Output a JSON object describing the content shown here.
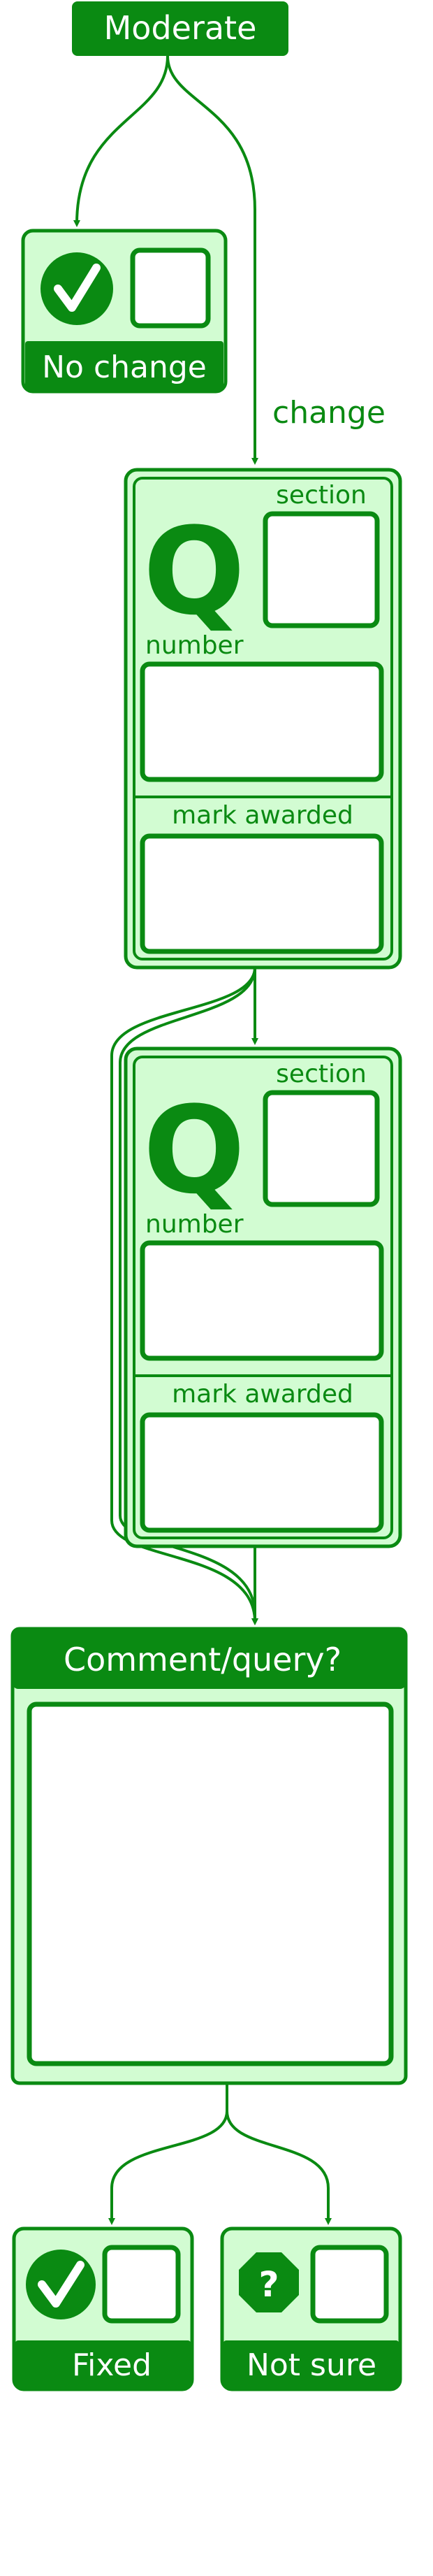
{
  "colors": {
    "green": "#0a8a12",
    "fill": "#d2fcd2",
    "white": "#ffffff"
  },
  "header": {
    "label": "Moderate"
  },
  "no_change": {
    "label": "No change",
    "icon": "checkmark-icon"
  },
  "change_label": "change",
  "question_blocks": [
    {
      "letter": "Q",
      "section_label": "section",
      "number_label": "number",
      "mark_label": "mark awarded"
    },
    {
      "letter": "Q",
      "section_label": "section",
      "number_label": "number",
      "mark_label": "mark awarded"
    }
  ],
  "comment": {
    "title": "Comment/query?"
  },
  "outcomes": [
    {
      "label": "Fixed",
      "icon": "checkmark-icon"
    },
    {
      "label": "Not sure",
      "icon": "question-octagon-icon"
    }
  ]
}
